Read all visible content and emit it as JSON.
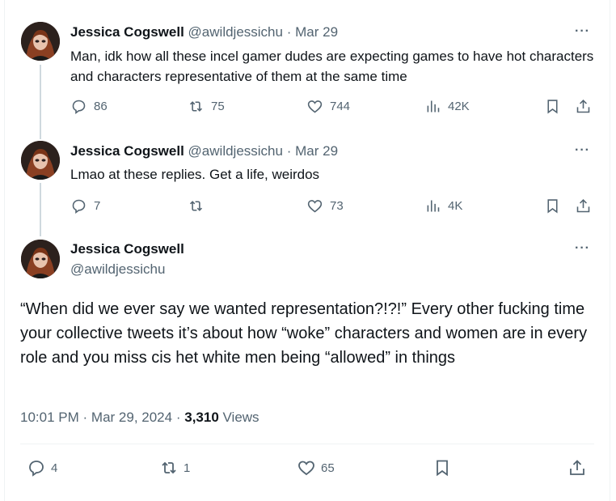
{
  "tweets": [
    {
      "name": "Jessica Cogswell",
      "handle": "@awildjessichu",
      "sep": "·",
      "date": "Mar 29",
      "text": "Man, idk how all these incel gamer dudes are expecting games to have hot characters and characters representative of them at the same time",
      "replies": "86",
      "retweets": "75",
      "likes": "744",
      "views": "42K"
    },
    {
      "name": "Jessica Cogswell",
      "handle": "@awildjessichu",
      "sep": "·",
      "date": "Mar 29",
      "text": "Lmao at these replies. Get a life, weirdos",
      "replies": "7",
      "retweets": "",
      "likes": "73",
      "views": "4K"
    }
  ],
  "main": {
    "name": "Jessica Cogswell",
    "handle": "@awildjessichu",
    "text": "“When did we ever say we wanted representation?!?!” Every other fucking time your collective tweets it’s about how “woke” characters and women are in every role and you miss cis het white men being “allowed” in things",
    "time": "10:01 PM",
    "sep1": "·",
    "date": "Mar 29, 2024",
    "sep2": "·",
    "views_count": "3,310",
    "views_label": "Views",
    "replies": "4",
    "retweets": "1",
    "likes": "65"
  },
  "more_label": "···",
  "icons": [
    "reply-icon",
    "retweet-icon",
    "like-icon",
    "views-icon",
    "bookmark-icon",
    "share-icon",
    "more-icon"
  ]
}
